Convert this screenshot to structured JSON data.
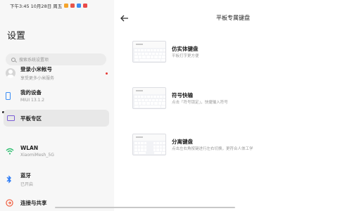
{
  "status_bar": {
    "time_date": "下午3:45  10月28日 周五",
    "notif_colors": [
      "#f4a42c",
      "#e7554a",
      "#3b8ef2",
      "#ea4a4a"
    ]
  },
  "left_pane": {
    "title": "设置",
    "search": {
      "placeholder": "搜索系统设置项",
      "icon": "search-icon"
    },
    "items": [
      {
        "title": "登录小米帐号",
        "subtitle": "享受更多小米服务",
        "icon": "avatar-icon",
        "badge": "red-dot"
      },
      {
        "title": "我的设备",
        "subtitle": "MIUI 13.1.2",
        "icon": "phone-icon"
      },
      {
        "title": "平板专区",
        "subtitle": "",
        "icon": "tablet-icon",
        "selected": true
      },
      {
        "title": "WLAN",
        "subtitle": "XiaomiMesh_5G",
        "icon": "wifi-icon"
      },
      {
        "title": "蓝牙",
        "subtitle": "已开启",
        "icon": "bluetooth-icon"
      },
      {
        "title": "连接与共享",
        "subtitle": "",
        "icon": "share-icon"
      }
    ]
  },
  "right_pane": {
    "title": "平板专属键盘",
    "back_icon": "back-arrow-icon",
    "options": [
      {
        "title": "仿实体键盘",
        "desc": "平板打字更方便"
      },
      {
        "title": "符号快输",
        "desc": "点击「符号锁定」，快捷输入符号"
      },
      {
        "title": "分离键盘",
        "desc": "点击左右角按键进行左右切换，更符合人体工学"
      }
    ]
  },
  "colors": {
    "accent_blue": "#3a8df5",
    "tablet_purple": "#7a5cd6",
    "wifi_green": "#2fbf71",
    "bluetooth_blue": "#2f7df6",
    "share_red": "#f05a3a"
  }
}
